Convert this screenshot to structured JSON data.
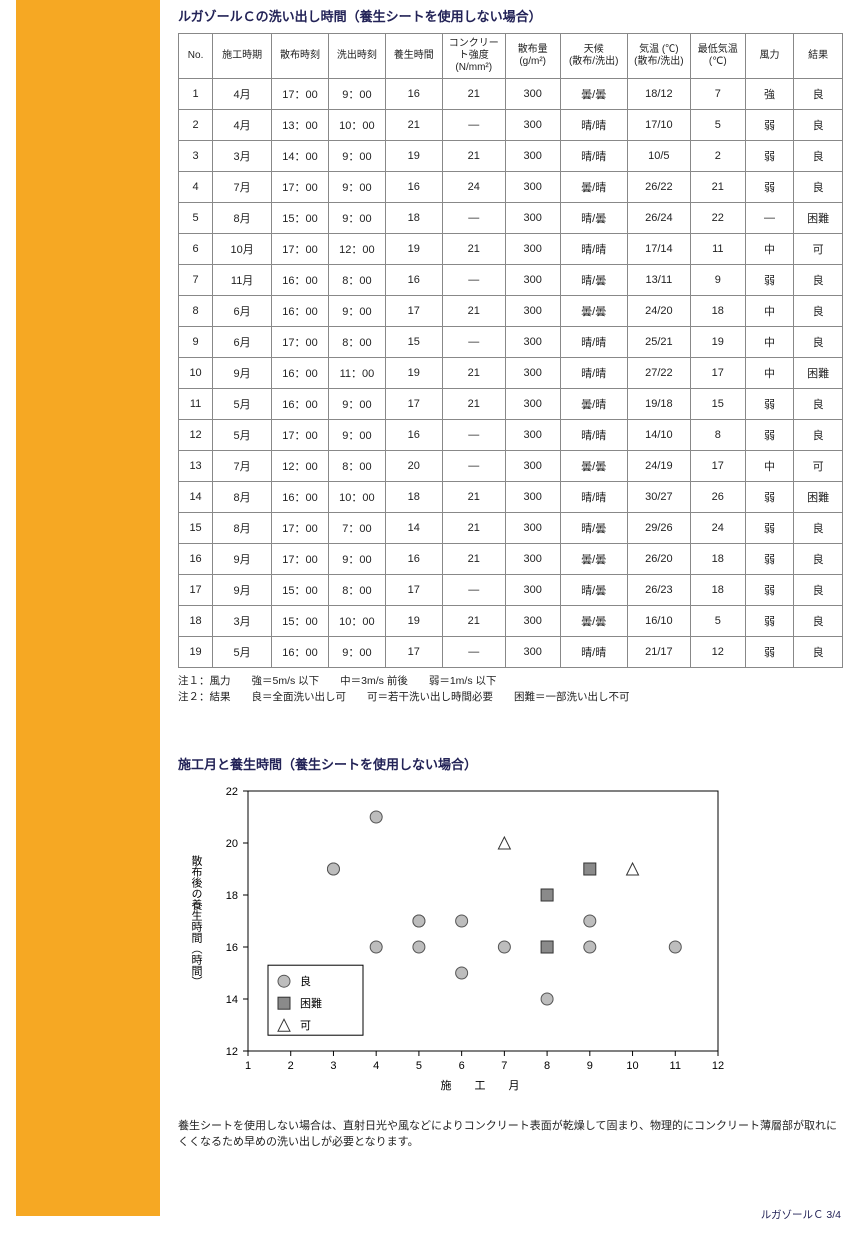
{
  "table_title": "ルガゾールＣの洗い出し時間（養生シートを使用しない場合）",
  "headers": {
    "no": "No.",
    "month": "施工時期",
    "spray": "散布時刻",
    "wash": "洗出時刻",
    "cure": "養生時間",
    "conc": "コンクリート強度\n(N/mm²)",
    "amt": "散布量\n(g/m²)",
    "weather": "天候\n(散布/洗出)",
    "temp": "気温 (℃)\n(散布/洗出)",
    "mintemp": "最低気温\n(℃)",
    "wind": "風力",
    "result": "結果"
  },
  "rows": [
    {
      "no": "1",
      "month": "4月",
      "spray": "17：00",
      "wash": "9：00",
      "cure": "16",
      "conc": "21",
      "amt": "300",
      "weather": "曇/曇",
      "temp": "18/12",
      "mintemp": "7",
      "wind": "強",
      "result": "良"
    },
    {
      "no": "2",
      "month": "4月",
      "spray": "13：00",
      "wash": "10：00",
      "cure": "21",
      "conc": "—",
      "amt": "300",
      "weather": "晴/晴",
      "temp": "17/10",
      "mintemp": "5",
      "wind": "弱",
      "result": "良"
    },
    {
      "no": "3",
      "month": "3月",
      "spray": "14：00",
      "wash": "9：00",
      "cure": "19",
      "conc": "21",
      "amt": "300",
      "weather": "晴/晴",
      "temp": "10/5",
      "mintemp": "2",
      "wind": "弱",
      "result": "良"
    },
    {
      "no": "4",
      "month": "7月",
      "spray": "17：00",
      "wash": "9：00",
      "cure": "16",
      "conc": "24",
      "amt": "300",
      "weather": "曇/晴",
      "temp": "26/22",
      "mintemp": "21",
      "wind": "弱",
      "result": "良"
    },
    {
      "no": "5",
      "month": "8月",
      "spray": "15：00",
      "wash": "9：00",
      "cure": "18",
      "conc": "—",
      "amt": "300",
      "weather": "晴/曇",
      "temp": "26/24",
      "mintemp": "22",
      "wind": "—",
      "result": "困難"
    },
    {
      "no": "6",
      "month": "10月",
      "spray": "17：00",
      "wash": "12：00",
      "cure": "19",
      "conc": "21",
      "amt": "300",
      "weather": "晴/晴",
      "temp": "17/14",
      "mintemp": "11",
      "wind": "中",
      "result": "可"
    },
    {
      "no": "7",
      "month": "11月",
      "spray": "16：00",
      "wash": "8：00",
      "cure": "16",
      "conc": "—",
      "amt": "300",
      "weather": "晴/曇",
      "temp": "13/11",
      "mintemp": "9",
      "wind": "弱",
      "result": "良"
    },
    {
      "no": "8",
      "month": "6月",
      "spray": "16：00",
      "wash": "9：00",
      "cure": "17",
      "conc": "21",
      "amt": "300",
      "weather": "曇/曇",
      "temp": "24/20",
      "mintemp": "18",
      "wind": "中",
      "result": "良"
    },
    {
      "no": "9",
      "month": "6月",
      "spray": "17：00",
      "wash": "8：00",
      "cure": "15",
      "conc": "—",
      "amt": "300",
      "weather": "晴/晴",
      "temp": "25/21",
      "mintemp": "19",
      "wind": "中",
      "result": "良"
    },
    {
      "no": "10",
      "month": "9月",
      "spray": "16：00",
      "wash": "11：00",
      "cure": "19",
      "conc": "21",
      "amt": "300",
      "weather": "晴/晴",
      "temp": "27/22",
      "mintemp": "17",
      "wind": "中",
      "result": "困難"
    },
    {
      "no": "11",
      "month": "5月",
      "spray": "16：00",
      "wash": "9：00",
      "cure": "17",
      "conc": "21",
      "amt": "300",
      "weather": "曇/晴",
      "temp": "19/18",
      "mintemp": "15",
      "wind": "弱",
      "result": "良"
    },
    {
      "no": "12",
      "month": "5月",
      "spray": "17：00",
      "wash": "9：00",
      "cure": "16",
      "conc": "—",
      "amt": "300",
      "weather": "晴/晴",
      "temp": "14/10",
      "mintemp": "8",
      "wind": "弱",
      "result": "良"
    },
    {
      "no": "13",
      "month": "7月",
      "spray": "12：00",
      "wash": "8：00",
      "cure": "20",
      "conc": "—",
      "amt": "300",
      "weather": "曇/曇",
      "temp": "24/19",
      "mintemp": "17",
      "wind": "中",
      "result": "可"
    },
    {
      "no": "14",
      "month": "8月",
      "spray": "16：00",
      "wash": "10：00",
      "cure": "18",
      "conc": "21",
      "amt": "300",
      "weather": "晴/晴",
      "temp": "30/27",
      "mintemp": "26",
      "wind": "弱",
      "result": "困難"
    },
    {
      "no": "15",
      "month": "8月",
      "spray": "17：00",
      "wash": "7：00",
      "cure": "14",
      "conc": "21",
      "amt": "300",
      "weather": "晴/曇",
      "temp": "29/26",
      "mintemp": "24",
      "wind": "弱",
      "result": "良"
    },
    {
      "no": "16",
      "month": "9月",
      "spray": "17：00",
      "wash": "9：00",
      "cure": "16",
      "conc": "21",
      "amt": "300",
      "weather": "曇/曇",
      "temp": "26/20",
      "mintemp": "18",
      "wind": "弱",
      "result": "良"
    },
    {
      "no": "17",
      "month": "9月",
      "spray": "15：00",
      "wash": "8：00",
      "cure": "17",
      "conc": "—",
      "amt": "300",
      "weather": "晴/曇",
      "temp": "26/23",
      "mintemp": "18",
      "wind": "弱",
      "result": "良"
    },
    {
      "no": "18",
      "month": "3月",
      "spray": "15：00",
      "wash": "10：00",
      "cure": "19",
      "conc": "21",
      "amt": "300",
      "weather": "曇/曇",
      "temp": "16/10",
      "mintemp": "5",
      "wind": "弱",
      "result": "良"
    },
    {
      "no": "19",
      "month": "5月",
      "spray": "16：00",
      "wash": "9：00",
      "cure": "17",
      "conc": "—",
      "amt": "300",
      "weather": "晴/晴",
      "temp": "21/17",
      "mintemp": "12",
      "wind": "弱",
      "result": "良"
    }
  ],
  "note1": "注１：風力　　強＝5m/s 以下　　中＝3m/s 前後　　弱＝1m/s 以下",
  "note2": "注２：結果　　良＝全面洗い出し可　　可＝若干洗い出し時間必要　　困難＝一部洗い出し不可",
  "chart_title": "施工月と養生時間（養生シートを使用しない場合）",
  "chart_data": {
    "type": "scatter",
    "xlabel": "施　工　月",
    "ylabel": "散布後の養生時間（時間）",
    "xlim": [
      1,
      12
    ],
    "ylim": [
      12,
      22
    ],
    "xticks": [
      1,
      2,
      3,
      4,
      5,
      6,
      7,
      8,
      9,
      10,
      11,
      12
    ],
    "yticks": [
      12,
      14,
      16,
      18,
      20,
      22
    ],
    "series": [
      {
        "name": "良",
        "marker": "circle",
        "points": [
          [
            3,
            19
          ],
          [
            3,
            19
          ],
          [
            4,
            16
          ],
          [
            4,
            21
          ],
          [
            5,
            16
          ],
          [
            5,
            17
          ],
          [
            5,
            17
          ],
          [
            6,
            15
          ],
          [
            6,
            17
          ],
          [
            7,
            16
          ],
          [
            8,
            14
          ],
          [
            9,
            16
          ],
          [
            9,
            17
          ],
          [
            11,
            16
          ]
        ]
      },
      {
        "name": "困難",
        "marker": "square",
        "points": [
          [
            8,
            18
          ],
          [
            8,
            16
          ],
          [
            9,
            19
          ]
        ]
      },
      {
        "name": "可",
        "marker": "triangle",
        "points": [
          [
            7,
            20
          ],
          [
            10,
            19
          ]
        ]
      }
    ],
    "legend": [
      "良",
      "困難",
      "可"
    ]
  },
  "caption": "養生シートを使用しない場合は、直射日光や風などによりコンクリート表面が乾燥して固まり、物理的にコンクリート薄層部が取れにくくなるため早めの洗い出しが必要となります。",
  "footer": "ルガゾールＣ 3/4"
}
